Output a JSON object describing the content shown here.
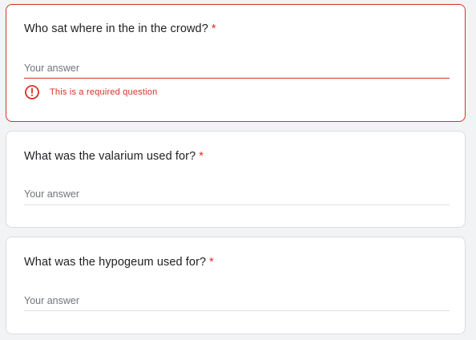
{
  "questions": [
    {
      "title": "Who sat where in the in the crowd?",
      "required_mark": "*",
      "placeholder": "Your answer",
      "value": "",
      "error": "This is a required question"
    },
    {
      "title": "What was the valarium used for?",
      "required_mark": "*",
      "placeholder": "Your answer",
      "value": ""
    },
    {
      "title": "What was the hypogeum used for?",
      "required_mark": "*",
      "placeholder": "Your answer",
      "value": ""
    }
  ],
  "colors": {
    "error": "#d93025",
    "text": "#202124",
    "placeholder": "#70757a",
    "divider": "#e0e0e0"
  },
  "icons": {
    "error": "error-circle-icon"
  }
}
